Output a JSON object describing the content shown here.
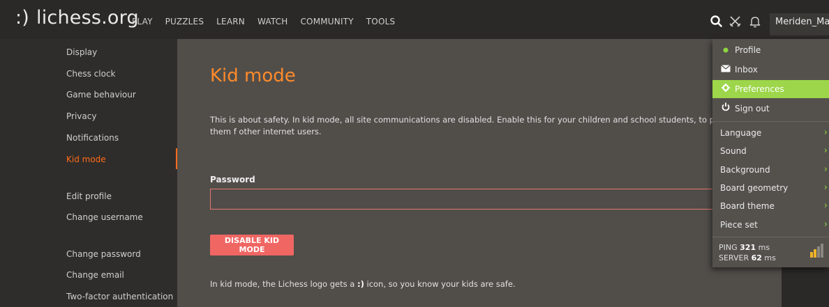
{
  "header": {
    "logo_mark": ":)",
    "site_name": "lichess.org",
    "nav": [
      "PLAY",
      "PUZZLES",
      "LEARN",
      "WATCH",
      "COMMUNITY",
      "TOOLS"
    ],
    "username": "Meriden_Mag",
    "icons": [
      "search-icon",
      "swords-icon",
      "bell-icon"
    ]
  },
  "sidebar": {
    "items": [
      {
        "label": "Display"
      },
      {
        "label": "Chess clock"
      },
      {
        "label": "Game behaviour"
      },
      {
        "label": "Privacy"
      },
      {
        "label": "Notifications"
      },
      {
        "label": "Kid mode",
        "active": true
      },
      {
        "label": "Edit profile"
      },
      {
        "label": "Change username"
      },
      {
        "label": "Change password"
      },
      {
        "label": "Change email"
      },
      {
        "label": "Two-factor authentication"
      }
    ]
  },
  "main": {
    "title": "Kid mode",
    "description": "This is about safety. In kid mode, all site communications are disabled. Enable this for your children and school students, to protect them f other internet users.",
    "password_label": "Password",
    "password_value": "",
    "disable_button": "DISABLE KID MODE",
    "note_prefix": "In kid mode, the Lichess logo gets a ",
    "note_icon": ":)",
    "note_suffix": " icon, so you know your kids are safe."
  },
  "dropdown": {
    "items": [
      {
        "label": "Profile",
        "icon": "online-dot-icon"
      },
      {
        "label": "Inbox",
        "icon": "envelope-icon"
      },
      {
        "label": "Preferences",
        "icon": "gear-icon",
        "highlighted": true
      },
      {
        "label": "Sign out",
        "icon": "power-icon"
      }
    ],
    "submenus": [
      "Language",
      "Sound",
      "Background",
      "Board geometry",
      "Board theme",
      "Piece set"
    ],
    "ping_label": "PING",
    "ping_value": "321",
    "ping_unit": "ms",
    "server_label": "SERVER",
    "server_value": "62",
    "server_unit": "ms"
  },
  "colors": {
    "accent_orange": "#ff8a2a",
    "active_orange": "#ff6b1a",
    "highlight_green": "#9dd64a",
    "button_red": "#f06663"
  }
}
